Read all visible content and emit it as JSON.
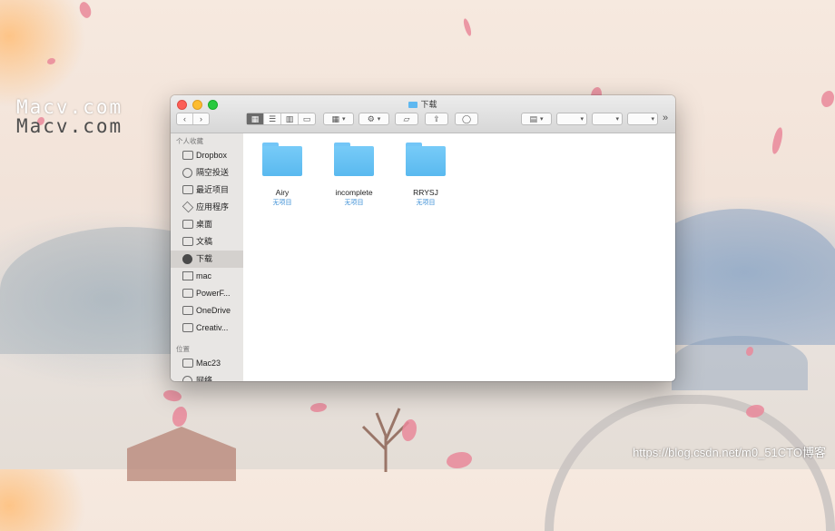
{
  "watermark": {
    "line1": "Macv.com",
    "line2": "Macv.com"
  },
  "footer": {
    "mark": "https://blog.csdn.net/m0_51CTO博客"
  },
  "window": {
    "title": "下载",
    "colors": {
      "folder": "#5ab9ef",
      "sidebar": "#e8e6e4",
      "selected_row": "#d4d1ce"
    },
    "toolbar": {
      "back_icon": "‹",
      "forward_icon": "›",
      "view_icon_mode": "▦",
      "view_list_mode": "☰",
      "view_column_mode": "▥",
      "view_gallery_mode": "▭",
      "group_icon": "▦",
      "action_icon": "⚙",
      "new_folder_icon": "▱",
      "share_icon": "⇪",
      "tag_icon": "◯",
      "calc_icon": "▤",
      "more_icon": "»"
    },
    "sidebar": {
      "favorites_header": "个人收藏",
      "favorites": [
        {
          "label": "Dropbox",
          "icon": "folder-icon"
        },
        {
          "label": "隔空投送",
          "icon": "airdrop-icon"
        },
        {
          "label": "最近项目",
          "icon": "recents-icon"
        },
        {
          "label": "应用程序",
          "icon": "applications-icon"
        },
        {
          "label": "桌面",
          "icon": "desktop-icon"
        },
        {
          "label": "文稿",
          "icon": "documents-icon"
        },
        {
          "label": "下载",
          "icon": "downloads-icon"
        },
        {
          "label": "mac",
          "icon": "home-icon"
        },
        {
          "label": "PowerF...",
          "icon": "folder-icon"
        },
        {
          "label": "OneDrive",
          "icon": "folder-icon"
        },
        {
          "label": "Creativ...",
          "icon": "folder-icon"
        }
      ],
      "locations_header": "位置",
      "locations": [
        {
          "label": "Mac23",
          "icon": "computer-icon"
        },
        {
          "label": "网络",
          "icon": "network-icon"
        }
      ]
    },
    "files": [
      {
        "name": "Airy",
        "sub": "无项目"
      },
      {
        "name": "incomplete",
        "sub": "无项目"
      },
      {
        "name": "RRYSJ",
        "sub": "无项目"
      }
    ]
  }
}
